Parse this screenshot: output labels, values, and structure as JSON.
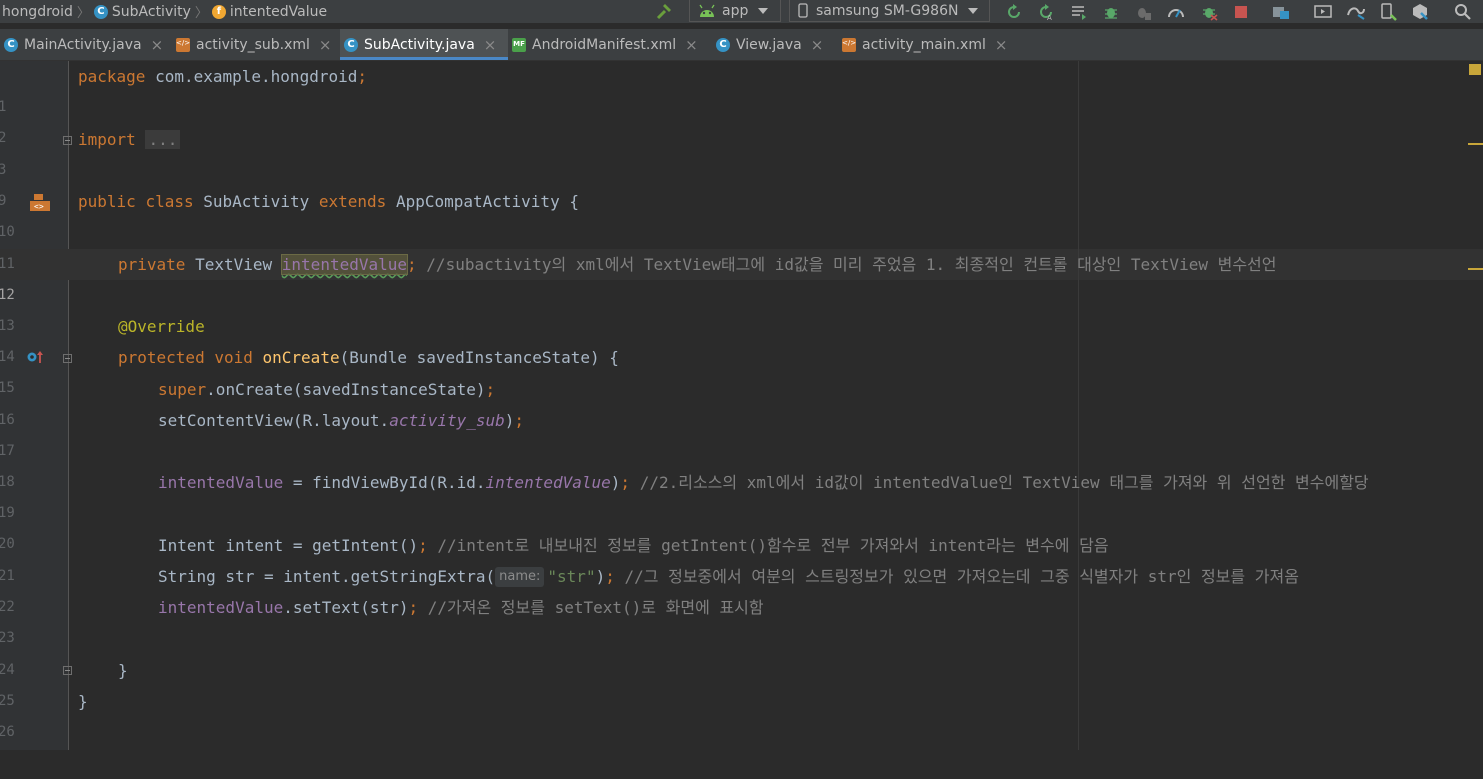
{
  "breadcrumb": {
    "project": "hongdroid",
    "class_name": "SubActivity",
    "field_name": "intentedValue"
  },
  "toolbar": {
    "run_config": "app",
    "device": "samsung SM-G986N"
  },
  "tabs": [
    {
      "label": "MainActivity.java",
      "icon": "class-icon",
      "active": false
    },
    {
      "label": "activity_sub.xml",
      "icon": "xml-layout-icon",
      "active": false
    },
    {
      "label": "SubActivity.java",
      "icon": "class-icon",
      "active": true
    },
    {
      "label": "AndroidManifest.xml",
      "icon": "manifest-icon",
      "active": false
    },
    {
      "label": "View.java",
      "icon": "class-icon",
      "active": false
    },
    {
      "label": "activity_main.xml",
      "icon": "xml-layout-icon",
      "active": false
    }
  ],
  "code": {
    "line_numbers": [
      "1",
      "2",
      "3",
      "9",
      "10",
      "11",
      "12",
      "13",
      "14",
      "15",
      "16",
      "17",
      "18",
      "19",
      "20",
      "21",
      "22",
      "23",
      "24",
      "25",
      "26"
    ],
    "current_line": "12",
    "l1": {
      "kw": "package",
      "rest": " com.example.hongdroid",
      "semi": ";"
    },
    "l3": {
      "kw": "import",
      "folded": "..."
    },
    "l10": {
      "kw1": "public",
      "kw2": "class",
      "name": "SubActivity",
      "kw3": "extends",
      "parent": "AppCompatActivity",
      "brace": " {"
    },
    "l12": {
      "kw": "private",
      "type": "TextView",
      "field": "intentedValue",
      "semi": ";",
      "comment": "//subactivity의 xml에서 TextView태그에 id값을 미리 주었음 1. 최종적인 컨트롤 대상인 TextView 변수선언"
    },
    "l14": {
      "annotation": "@Override"
    },
    "l15": {
      "kw1": "protected",
      "kw2": "void",
      "method": "onCreate",
      "params": "(Bundle savedInstanceState) {"
    },
    "l16": {
      "kw": "super",
      "rest": ".onCreate(savedInstanceState)",
      "semi": ";"
    },
    "l17": {
      "call": "setContentView(R.layout.",
      "const": "activity_sub",
      "close": ")",
      "semi": ";"
    },
    "l19": {
      "field": "intentedValue",
      "mid": " = findViewById(R.id.",
      "const": "intentedValue",
      "close": ")",
      "semi": ";",
      "comment": "//2.리소스의 xml에서 id값이 intentedValue인 TextView 태그를 가져와 위 선언한 변수에할당"
    },
    "l21": {
      "code": "Intent intent = getIntent()",
      "semi": ";",
      "comment": "//intent로 내보내진 정보를 getIntent()함수로 전부 가져와서 intent라는 변수에 담음"
    },
    "l22": {
      "code": "String str = intent.getStringExtra(",
      "hint": "name:",
      "string": "\"str\"",
      "close": ")",
      "semi": ";",
      "comment": "//그 정보중에서 여분의 스트링정보가 있으면 가져오는데 그중 식별자가 str인 정보를 가져옴"
    },
    "l23": {
      "field": "intentedValue",
      "call": ".setText(str)",
      "semi": ";",
      "comment": "//가져온 정보를 setText()로 화면에 표시함"
    },
    "l25": {
      "brace": "}"
    },
    "l26": {
      "brace": "}"
    }
  },
  "colors": {
    "background": "#2b2b2b",
    "keyword": "#cc7832",
    "field": "#9876aa",
    "method": "#ffc66d",
    "string": "#6a8759",
    "comment": "#808080",
    "annotation": "#bbb529",
    "accent": "#4a88c7"
  }
}
